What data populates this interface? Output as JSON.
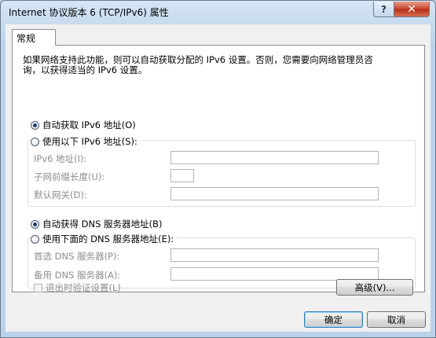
{
  "window": {
    "title": "Internet 协议版本 6 (TCP/IPv6) 属性",
    "help_label": "?",
    "close_label": "✕"
  },
  "tabs": [
    {
      "label": "常规",
      "selected": true
    }
  ],
  "general": {
    "description_line1": "如果网络支持此功能，则可以自动获取分配的 IPv6 设置。否则，您需要向网络管理员咨",
    "description_line2": "询，以获得适当的 IPv6 设置。",
    "ip_auto_label": "自动获取 IPv6 地址(O)",
    "ip_manual_label": "使用以下 IPv6 地址(S):",
    "ip_mode": "auto",
    "ipv6_address_label": "IPv6 地址(I):",
    "ipv6_address_value": "",
    "prefix_length_label": "子网前缀长度(U):",
    "prefix_length_value": "",
    "gateway_label": "默认网关(D):",
    "gateway_value": "",
    "dns_auto_label": "自动获得 DNS 服务器地址(B)",
    "dns_manual_label": "使用下面的 DNS 服务器地址(E):",
    "dns_mode": "auto",
    "preferred_dns_label": "首选 DNS 服务器(P):",
    "preferred_dns_value": "",
    "alternate_dns_label": "备用 DNS 服务器(A):",
    "alternate_dns_value": "",
    "validate_on_exit_label": "退出时验证设置(L)",
    "validate_on_exit_checked": false,
    "advanced_label": "高级(V)..."
  },
  "footer": {
    "ok_label": "确定",
    "cancel_label": "取消"
  },
  "colors": {
    "window_frame": "#b9d1ea",
    "disabled_text": "#8d8d8d",
    "close_button": "#c9442a"
  }
}
